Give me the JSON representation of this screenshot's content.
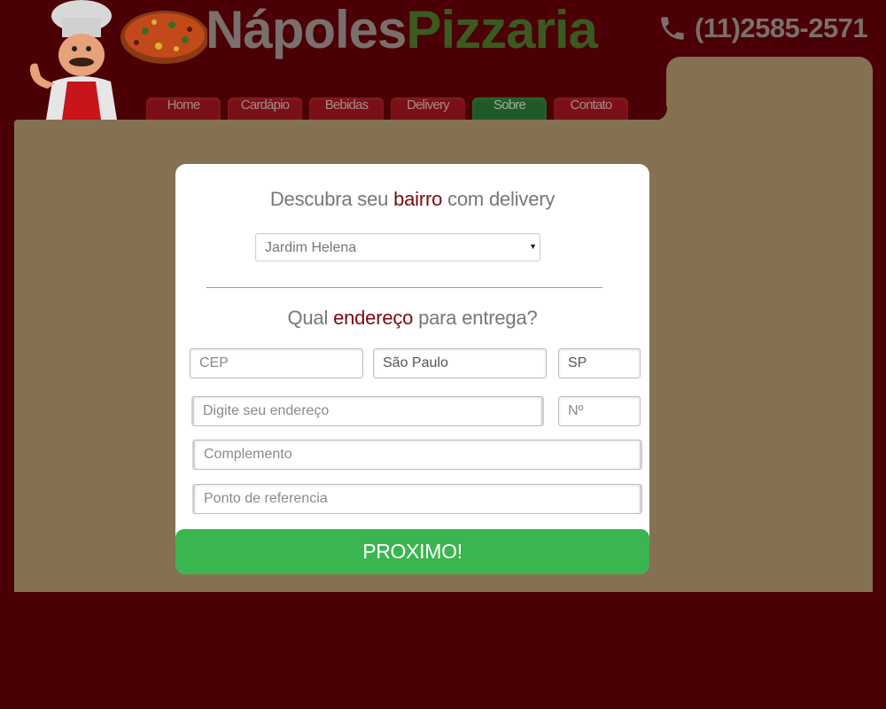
{
  "brand": {
    "part1": "Nápoles",
    "part2": "Pizzaria"
  },
  "phone": {
    "icon": "phone-icon",
    "number": "(11)2585-2571"
  },
  "nav": {
    "items": [
      {
        "label": "Home"
      },
      {
        "label": "Cardápio"
      },
      {
        "label": "Bebidas"
      },
      {
        "label": "Delivery"
      },
      {
        "label": "Sobre"
      },
      {
        "label": "Contato"
      }
    ],
    "active": "Sobre"
  },
  "modal": {
    "heading1": {
      "before": "Descubra seu ",
      "highlight": "bairro",
      "after": " com delivery"
    },
    "bairro_select": {
      "value": "Jardim Helena"
    },
    "heading2": {
      "before": "Qual ",
      "highlight": "endereço",
      "after": " para entrega?"
    },
    "fields": {
      "cep": {
        "placeholder": "CEP"
      },
      "city": {
        "value": "São Paulo"
      },
      "state": {
        "value": "SP"
      },
      "address": {
        "placeholder": "Digite seu endereço"
      },
      "number": {
        "placeholder": "Nº"
      },
      "complement": {
        "placeholder": "Complemento"
      },
      "reference": {
        "placeholder": "Ponto de referencia"
      }
    },
    "submit_label": "PROXIMO!"
  },
  "colors": {
    "background": "#4a0004",
    "panel": "#847152",
    "nav_tab": "#7a0f17",
    "nav_tab_active": "#1f5a26",
    "brand_grey": "#7a6f6c",
    "brand_green": "#3b5a1f",
    "highlight": "#7a0a10",
    "button": "#3bb54f"
  }
}
